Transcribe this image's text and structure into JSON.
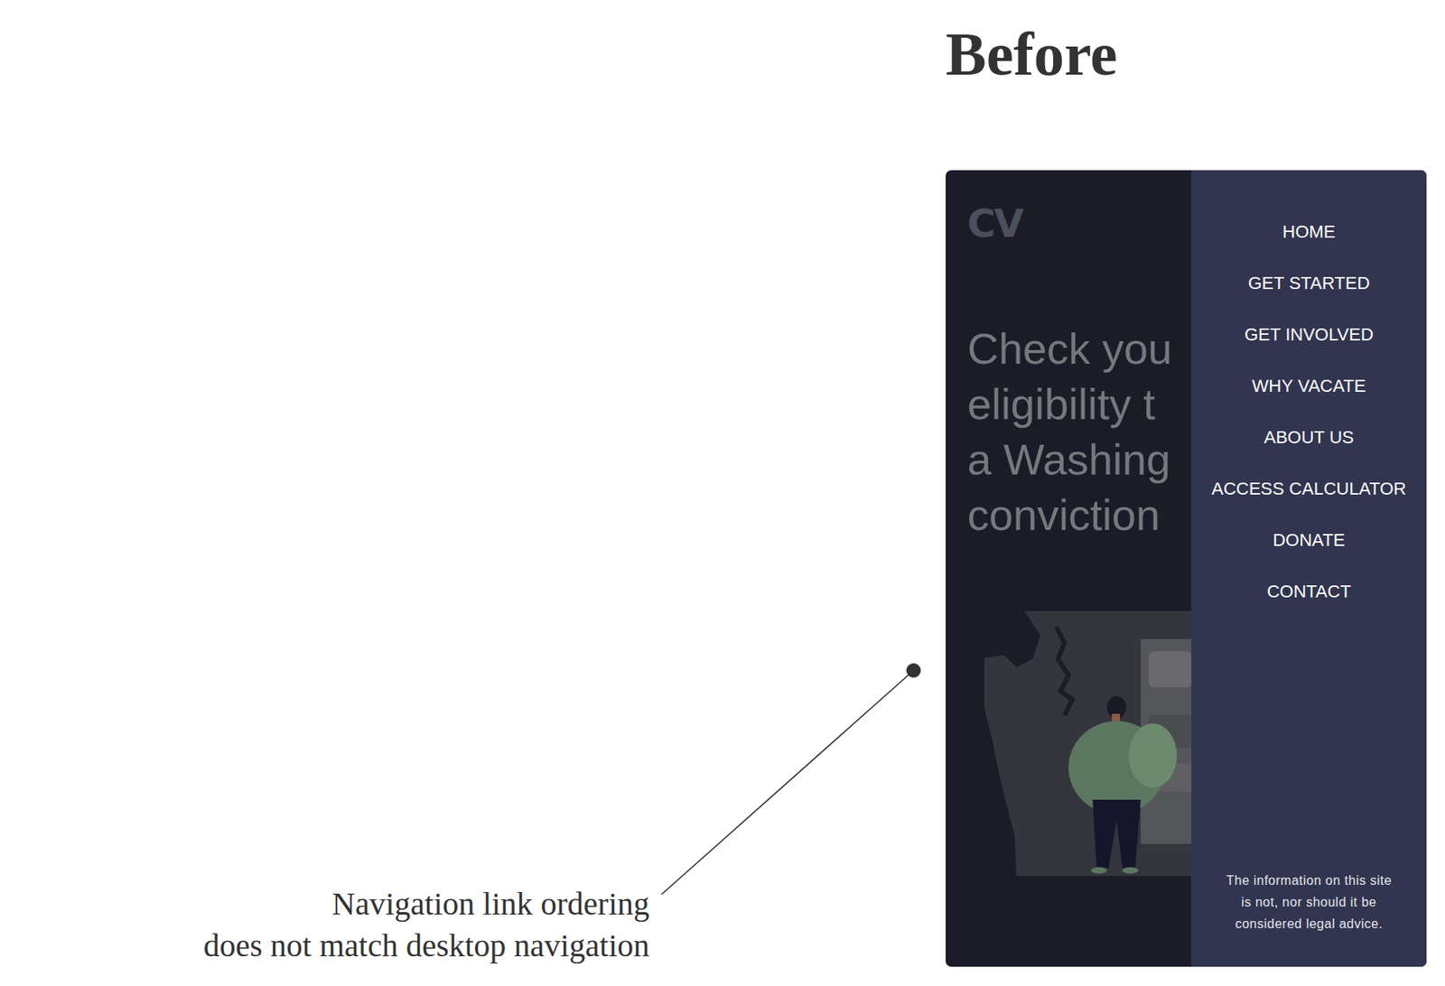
{
  "heading": "Before",
  "annotation": {
    "lines": [
      "Navigation link ordering",
      "does not match desktop navigation"
    ]
  },
  "phone": {
    "logo": "CV",
    "headline": [
      "Check you",
      "eligibility t",
      "a Washing",
      "conviction"
    ],
    "menu": {
      "items": [
        "HOME",
        "GET STARTED",
        "GET INVOLVED",
        "WHY VACATE",
        "ABOUT US",
        "ACCESS CALCULATOR",
        "DONATE",
        "CONTACT"
      ],
      "disclaimer": "The information on this site is not, nor should it be considered legal advice."
    }
  }
}
